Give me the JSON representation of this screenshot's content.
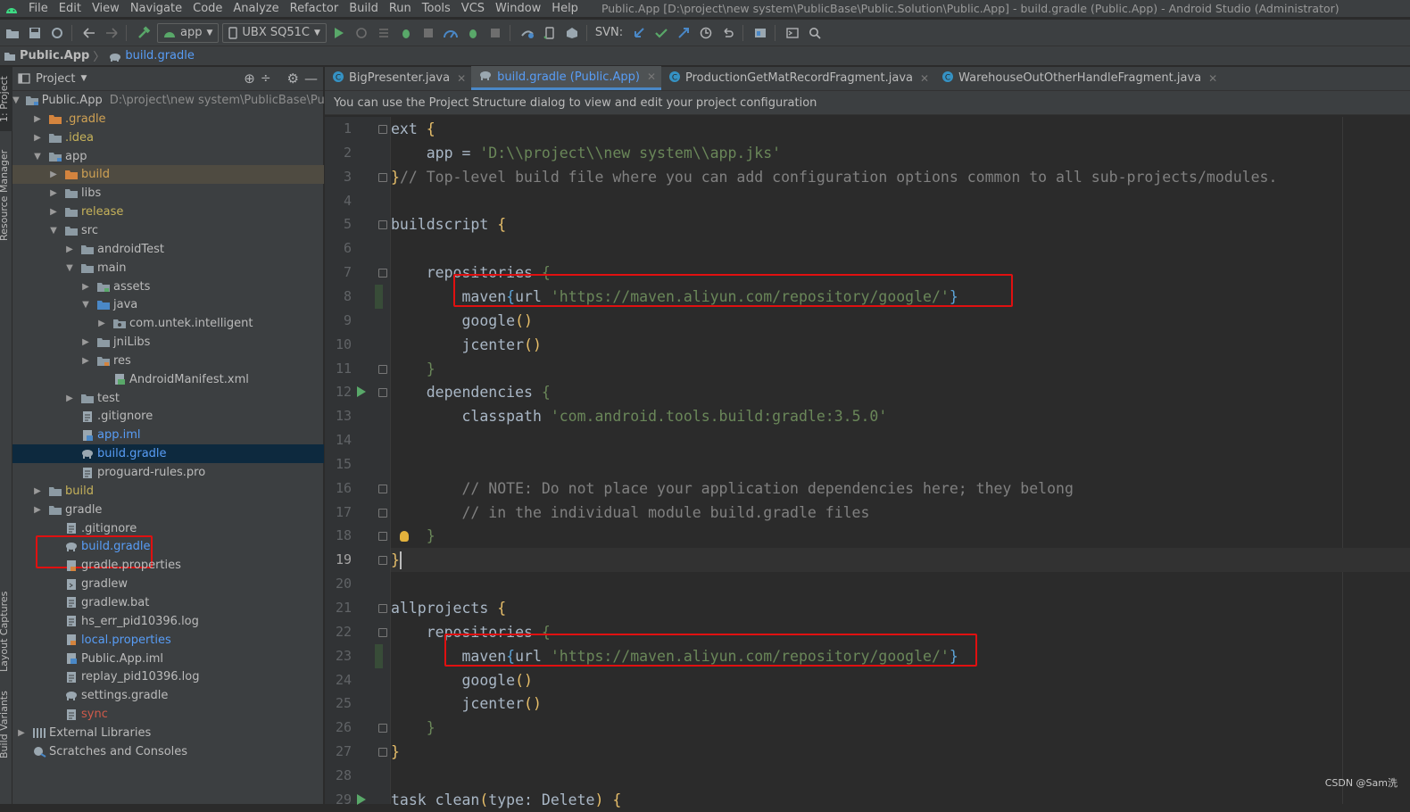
{
  "menubar": {
    "items": [
      "File",
      "Edit",
      "View",
      "Navigate",
      "Code",
      "Analyze",
      "Refactor",
      "Build",
      "Run",
      "Tools",
      "VCS",
      "Window",
      "Help"
    ],
    "window_title": "Public.App [D:\\project\\new system\\PublicBase\\Public.Solution\\Public.App] - build.gradle (Public.App) - Android Studio (Administrator)"
  },
  "toolbar": {
    "module_combo": "app",
    "device_combo": "UBX SQ51C",
    "svn_label": "SVN:"
  },
  "breadcrumb": {
    "project": "Public.App",
    "file": "build.gradle"
  },
  "side_stripe": {
    "project_label": "1: Project",
    "resource_manager": "Resource Manager",
    "layout_captures": "Layout Captures",
    "build_variants": "Build Variants"
  },
  "project_panel": {
    "title": "Project",
    "root_path": "D:\\project\\new system\\PublicBase\\Public.S",
    "tree": [
      {
        "label": "Public.App",
        "indent": 0,
        "arrow": "down",
        "icon": "module-folder",
        "color": "default",
        "bold": true
      },
      {
        "label": ".gradle",
        "indent": 1,
        "arrow": "right",
        "icon": "folder-orange",
        "color": "orange"
      },
      {
        "label": ".idea",
        "indent": 1,
        "arrow": "right",
        "icon": "folder",
        "color": "olive"
      },
      {
        "label": "app",
        "indent": 1,
        "arrow": "down",
        "icon": "module-folder",
        "color": "default"
      },
      {
        "label": "build",
        "indent": 2,
        "arrow": "right",
        "icon": "folder-orange",
        "color": "orange"
      },
      {
        "label": "libs",
        "indent": 2,
        "arrow": "right",
        "icon": "folder",
        "color": "default"
      },
      {
        "label": "release",
        "indent": 2,
        "arrow": "right",
        "icon": "folder",
        "color": "olive"
      },
      {
        "label": "src",
        "indent": 2,
        "arrow": "down",
        "icon": "folder",
        "color": "default"
      },
      {
        "label": "androidTest",
        "indent": 3,
        "arrow": "right",
        "icon": "folder",
        "color": "default"
      },
      {
        "label": "main",
        "indent": 3,
        "arrow": "down",
        "icon": "folder",
        "color": "default"
      },
      {
        "label": "assets",
        "indent": 4,
        "arrow": "right",
        "icon": "folder-assets",
        "color": "default"
      },
      {
        "label": "java",
        "indent": 4,
        "arrow": "down",
        "icon": "folder-blue",
        "color": "default"
      },
      {
        "label": "com.untek.intelligent",
        "indent": 5,
        "arrow": "right",
        "icon": "package",
        "color": "default"
      },
      {
        "label": "jniLibs",
        "indent": 4,
        "arrow": "right",
        "icon": "folder",
        "color": "default"
      },
      {
        "label": "res",
        "indent": 4,
        "arrow": "right",
        "icon": "folder-res",
        "color": "default"
      },
      {
        "label": "AndroidManifest.xml",
        "indent": 5,
        "arrow": "none",
        "icon": "xml-file",
        "color": "default"
      },
      {
        "label": "test",
        "indent": 3,
        "arrow": "right",
        "icon": "folder",
        "color": "default"
      },
      {
        "label": ".gitignore",
        "indent": 3,
        "arrow": "none",
        "icon": "text-file",
        "color": "default"
      },
      {
        "label": "app.iml",
        "indent": 3,
        "arrow": "none",
        "icon": "iml-file",
        "color": "blue"
      },
      {
        "label": "build.gradle",
        "indent": 3,
        "arrow": "none",
        "icon": "gradle-file",
        "color": "blue",
        "selected": true
      },
      {
        "label": "proguard-rules.pro",
        "indent": 3,
        "arrow": "none",
        "icon": "text-file",
        "color": "default"
      },
      {
        "label": "build",
        "indent": 1,
        "arrow": "right",
        "icon": "folder",
        "color": "olive"
      },
      {
        "label": "gradle",
        "indent": 1,
        "arrow": "right",
        "icon": "folder",
        "color": "default"
      },
      {
        "label": ".gitignore",
        "indent": 2,
        "arrow": "none",
        "icon": "text-file",
        "color": "default"
      },
      {
        "label": "build.gradle",
        "indent": 2,
        "arrow": "none",
        "icon": "gradle-file",
        "color": "blue",
        "boxed": true
      },
      {
        "label": "gradle.properties",
        "indent": 2,
        "arrow": "none",
        "icon": "properties-file",
        "color": "default"
      },
      {
        "label": "gradlew",
        "indent": 2,
        "arrow": "none",
        "icon": "script-file",
        "color": "default"
      },
      {
        "label": "gradlew.bat",
        "indent": 2,
        "arrow": "none",
        "icon": "text-file",
        "color": "default"
      },
      {
        "label": "hs_err_pid10396.log",
        "indent": 2,
        "arrow": "none",
        "icon": "text-file",
        "color": "default"
      },
      {
        "label": "local.properties",
        "indent": 2,
        "arrow": "none",
        "icon": "properties-file",
        "color": "blue"
      },
      {
        "label": "Public.App.iml",
        "indent": 2,
        "arrow": "none",
        "icon": "iml-file",
        "color": "default"
      },
      {
        "label": "replay_pid10396.log",
        "indent": 2,
        "arrow": "none",
        "icon": "text-file",
        "color": "default"
      },
      {
        "label": "settings.gradle",
        "indent": 2,
        "arrow": "none",
        "icon": "gradle-file",
        "color": "default"
      },
      {
        "label": "sync",
        "indent": 2,
        "arrow": "none",
        "icon": "text-file",
        "color": "red"
      },
      {
        "label": "External Libraries",
        "indent": 0,
        "arrow": "right",
        "icon": "libraries",
        "color": "default"
      },
      {
        "label": "Scratches and Consoles",
        "indent": 0,
        "arrow": "none",
        "icon": "scratches",
        "color": "default"
      }
    ]
  },
  "editor": {
    "tabs": [
      {
        "label": "BigPresenter.java",
        "icon": "class-icon",
        "active": false
      },
      {
        "label": "build.gradle (Public.App)",
        "icon": "gradle-icon",
        "active": true
      },
      {
        "label": "ProductionGetMatRecordFragment.java",
        "icon": "class-icon",
        "active": false
      },
      {
        "label": "WarehouseOutOtherHandleFragment.java",
        "icon": "class-icon",
        "active": false
      }
    ],
    "notice": "You can use the Project Structure dialog to view and edit your project configuration",
    "current_line": 19,
    "lines": [
      [
        {
          "t": "ext "
        },
        {
          "t": "{",
          "c": "br"
        }
      ],
      [
        {
          "t": "    app = "
        },
        {
          "t": "'D:\\\\project\\\\new system\\\\app.jks'",
          "c": "s"
        }
      ],
      [
        {
          "t": "}",
          "c": "br"
        },
        {
          "t": "// Top-level build file where you can add configuration options common to all sub-projects/modules.",
          "c": "cm"
        }
      ],
      [],
      [
        {
          "t": "buildscript "
        },
        {
          "t": "{",
          "c": "br"
        }
      ],
      [],
      [
        {
          "t": "    repositories "
        },
        {
          "t": "{",
          "c": "s"
        }
      ],
      [
        {
          "t": "        maven"
        },
        {
          "t": "{",
          "c": "hb"
        },
        {
          "t": "url "
        },
        {
          "t": "'https://maven.aliyun.com/repository/google/'",
          "c": "s"
        },
        {
          "t": "}",
          "c": "hb"
        }
      ],
      [
        {
          "t": "        google"
        },
        {
          "t": "()",
          "c": "br"
        }
      ],
      [
        {
          "t": "        jcenter"
        },
        {
          "t": "()",
          "c": "br"
        }
      ],
      [
        {
          "t": "    }",
          "c": "s"
        }
      ],
      [
        {
          "t": "    dependencies "
        },
        {
          "t": "{",
          "c": "s"
        }
      ],
      [
        {
          "t": "        classpath "
        },
        {
          "t": "'com.android.tools.build:gradle:3.5.0'",
          "c": "s"
        }
      ],
      [],
      [],
      [
        {
          "t": "        // NOTE: Do not place your application dependencies here; they belong",
          "c": "cm"
        }
      ],
      [
        {
          "t": "        // in the individual module build.gradle files",
          "c": "cm"
        }
      ],
      [
        {
          "t": "    }",
          "c": "s"
        }
      ],
      [
        {
          "t": "}",
          "c": "br"
        }
      ],
      [],
      [
        {
          "t": "allprojects "
        },
        {
          "t": "{",
          "c": "br"
        }
      ],
      [
        {
          "t": "    repositories "
        },
        {
          "t": "{",
          "c": "s"
        }
      ],
      [
        {
          "t": "        maven"
        },
        {
          "t": "{",
          "c": "hb"
        },
        {
          "t": "url "
        },
        {
          "t": "'https://maven.aliyun.com/repository/google/'",
          "c": "s"
        },
        {
          "t": "}",
          "c": "hb"
        }
      ],
      [
        {
          "t": "        google"
        },
        {
          "t": "()",
          "c": "br"
        }
      ],
      [
        {
          "t": "        jcenter"
        },
        {
          "t": "()",
          "c": "br"
        }
      ],
      [
        {
          "t": "    }",
          "c": "s"
        }
      ],
      [
        {
          "t": "}",
          "c": "br"
        }
      ],
      [],
      [
        {
          "t": "task clean"
        },
        {
          "t": "(",
          "c": "br"
        },
        {
          "t": "type: Delete"
        },
        {
          "t": ")",
          "c": "br"
        },
        {
          "t": " {",
          "c": "br"
        }
      ]
    ]
  },
  "watermark": "CSDN @Sam洗",
  "colors": {
    "accent": "#4a88c7",
    "annotation_red": "#e01010",
    "selection": "#0d293e"
  }
}
